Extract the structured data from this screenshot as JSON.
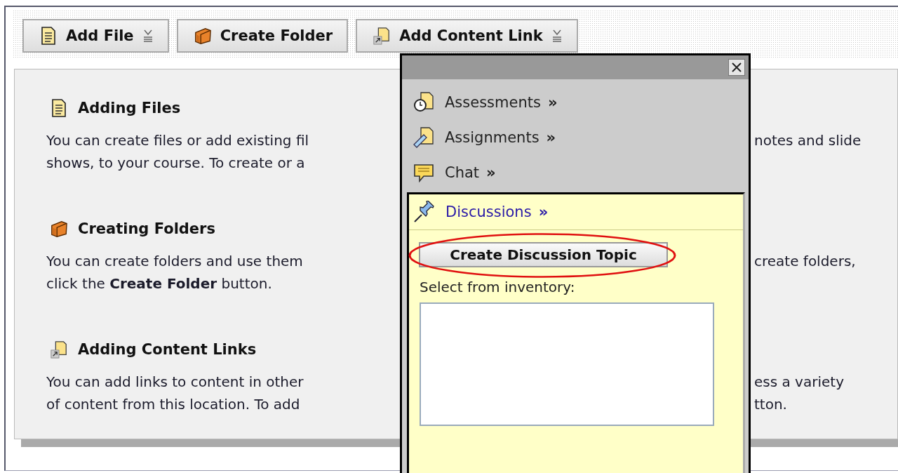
{
  "toolbar": {
    "buttons": [
      {
        "label": "Add File",
        "menu": true
      },
      {
        "label": "Create Folder",
        "menu": false
      },
      {
        "label": "Add Content Link",
        "menu": true
      }
    ]
  },
  "sections": [
    {
      "title": "Adding Files",
      "lines": [
        {
          "left": "You can create files or add existing fil",
          "right": "notes and slide"
        },
        {
          "left": "shows, to your course. To create or a"
        }
      ]
    },
    {
      "title": "Creating Folders",
      "lines": [
        {
          "left": "You can create folders and use them",
          "right": "create folders,"
        },
        {
          "left": "click the **Create Folder** button."
        }
      ]
    },
    {
      "title": "Adding Content Links",
      "lines": [
        {
          "left": "You can add links to content in other",
          "right": "ess a variety"
        },
        {
          "left": "of content from this location. To add",
          "right": "tton."
        }
      ]
    }
  ],
  "popup": {
    "items": [
      {
        "label": "Assessments",
        "arrow": "»",
        "selected": false
      },
      {
        "label": "Assignments",
        "arrow": "»",
        "selected": false
      },
      {
        "label": "Chat",
        "arrow": "»",
        "selected": false
      },
      {
        "label": "Discussions",
        "arrow": "»",
        "selected": true
      }
    ],
    "action_button": "Create Discussion Topic",
    "highlighted": true,
    "inventory_label": "Select from inventory:"
  }
}
